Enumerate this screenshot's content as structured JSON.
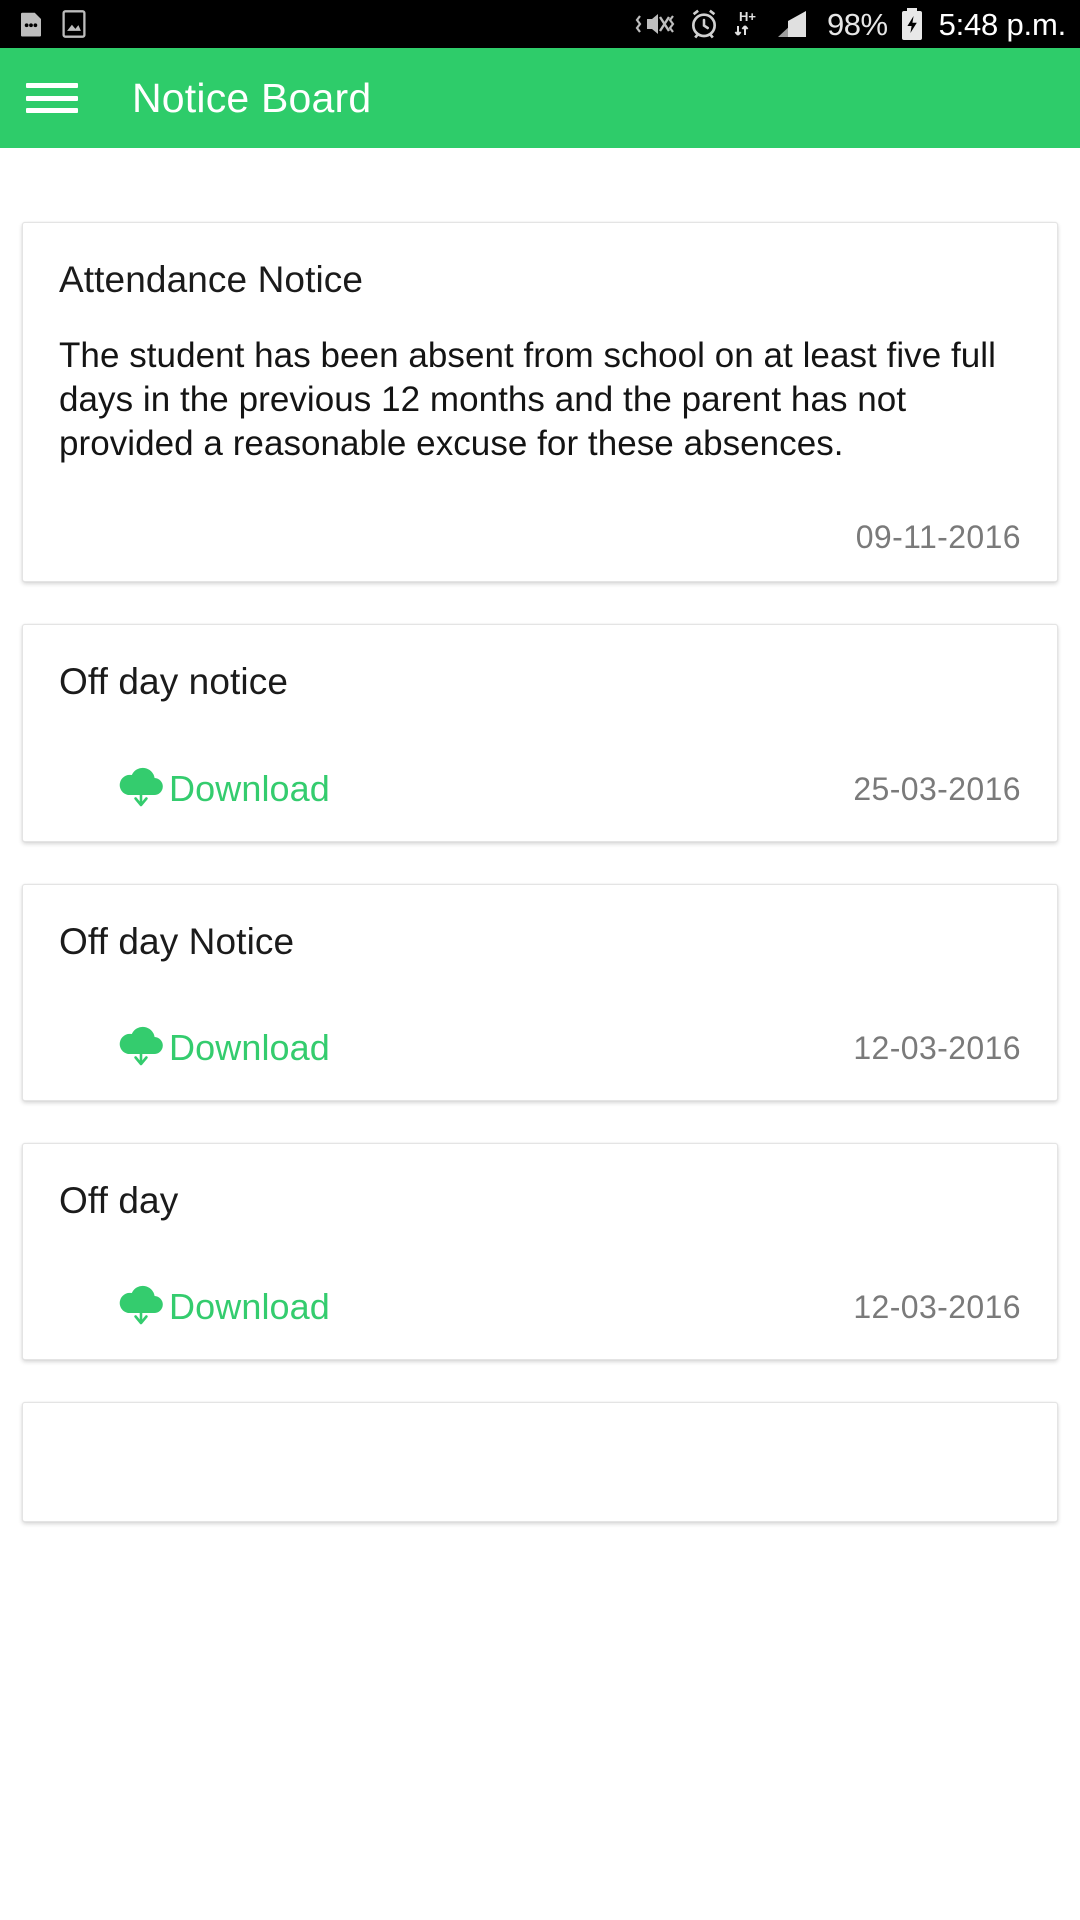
{
  "statusbar": {
    "time": "5:48 p.m.",
    "battery_percent": "98%",
    "left_icons": [
      "sim-card-icon",
      "gallery-image-icon"
    ],
    "right_icons": [
      "vibrate-mute-icon",
      "alarm-clock-icon",
      "hplus-data-icon",
      "signal-bars-icon"
    ],
    "battery_icon": "battery-charging-icon"
  },
  "appbar": {
    "title": "Notice Board",
    "menu_icon": "hamburger-menu-icon",
    "color": "#2ECC6A"
  },
  "accent_color": "#34CC6E",
  "download_label": "Download",
  "download_icon": "cloud-download-icon",
  "notices": [
    {
      "title": "Attendance Notice",
      "body": "The student has been absent from school on at least five full days in the previous 12 months and the parent has not provided a reasonable excuse for these absences.",
      "date": "09-11-2016",
      "has_download": false
    },
    {
      "title": "Off day notice",
      "body": "",
      "date": "25-03-2016",
      "has_download": true
    },
    {
      "title": "Off day Notice",
      "body": "",
      "date": "12-03-2016",
      "has_download": true
    },
    {
      "title": "Off day",
      "body": "",
      "date": "12-03-2016",
      "has_download": true
    },
    {
      "title": "",
      "body": "",
      "date": "",
      "has_download": false
    }
  ]
}
